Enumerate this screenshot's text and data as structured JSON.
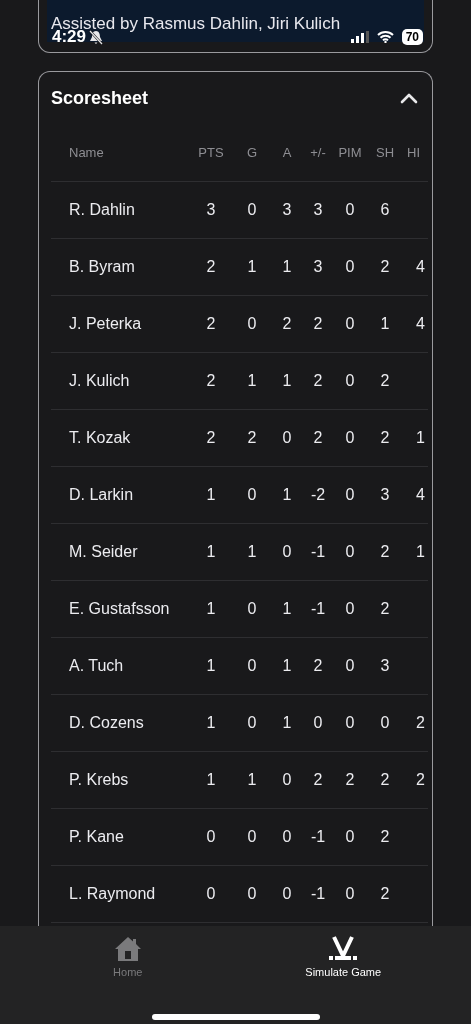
{
  "status_bar": {
    "time": "4:29",
    "battery": "70"
  },
  "goal_card": {
    "lines": [
      "Assisted by Rasmus Dahlin, Jiri Kulich"
    ]
  },
  "scoresheet": {
    "title": "Scoresheet",
    "expanded": true,
    "columns": [
      "Name",
      "PTS",
      "G",
      "A",
      "+/-",
      "PIM",
      "SH",
      "HI"
    ],
    "rows": [
      {
        "cells": [
          "R. Dahlin",
          "3",
          "0",
          "3",
          "3",
          "0",
          "6"
        ]
      },
      {
        "cells": [
          "B. Byram",
          "2",
          "1",
          "1",
          "3",
          "0",
          "2",
          "4"
        ]
      },
      {
        "cells": [
          "J. Peterka",
          "2",
          "0",
          "2",
          "2",
          "0",
          "1",
          "4"
        ]
      },
      {
        "cells": [
          "J. Kulich",
          "2",
          "1",
          "1",
          "2",
          "0",
          "2"
        ]
      },
      {
        "cells": [
          "T. Kozak",
          "2",
          "2",
          "0",
          "2",
          "0",
          "2",
          "1"
        ]
      },
      {
        "cells": [
          "D. Larkin",
          "1",
          "0",
          "1",
          "-2",
          "0",
          "3",
          "4"
        ]
      },
      {
        "cells": [
          "M. Seider",
          "1",
          "1",
          "0",
          "-1",
          "0",
          "2",
          "1"
        ]
      },
      {
        "cells": [
          "E. Gustafsson",
          "1",
          "0",
          "1",
          "-1",
          "0",
          "2"
        ]
      },
      {
        "cells": [
          "A. Tuch",
          "1",
          "0",
          "1",
          "2",
          "0",
          "3"
        ]
      },
      {
        "cells": [
          "D. Cozens",
          "1",
          "0",
          "1",
          "0",
          "0",
          "0",
          "2"
        ]
      },
      {
        "cells": [
          "P. Krebs",
          "1",
          "1",
          "0",
          "2",
          "2",
          "2",
          "2"
        ]
      },
      {
        "cells": [
          "P. Kane",
          "0",
          "0",
          "0",
          "-1",
          "0",
          "2"
        ]
      },
      {
        "cells": [
          "L. Raymond",
          "0",
          "0",
          "0",
          "-1",
          "0",
          "2"
        ]
      }
    ]
  },
  "tab_bar": [
    {
      "label": "Home",
      "kind": "home",
      "selected": false
    },
    {
      "label": "Simulate Game",
      "kind": "sticks",
      "selected": true
    }
  ]
}
